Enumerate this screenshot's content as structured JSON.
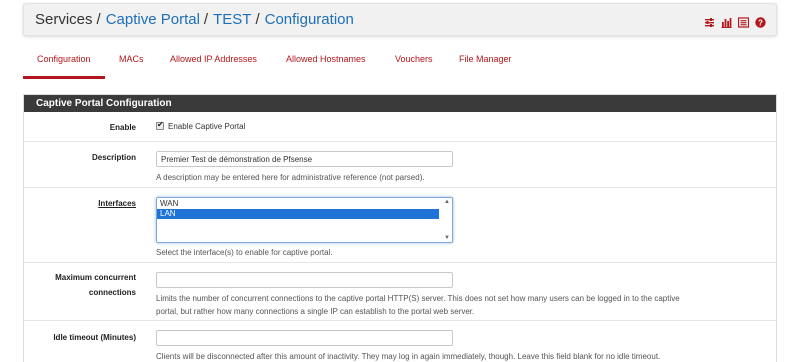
{
  "breadcrumb": {
    "items": [
      "Services",
      "Captive Portal",
      "TEST",
      "Configuration"
    ],
    "separator": "/"
  },
  "header_icons": [
    "sliders-icon",
    "bar-chart-icon",
    "list-icon",
    "help-icon"
  ],
  "tabs": [
    {
      "label": "Configuration",
      "active": true
    },
    {
      "label": "MACs"
    },
    {
      "label": "Allowed IP Addresses"
    },
    {
      "label": "Allowed Hostnames"
    },
    {
      "label": "Vouchers"
    },
    {
      "label": "File Manager"
    }
  ],
  "panel": {
    "title": "Captive Portal Configuration",
    "enable": {
      "label": "Enable",
      "checkbox_label": "Enable Captive Portal",
      "checked": true
    },
    "description": {
      "label": "Description",
      "value": "Premier Test de démonstration de Pfsense",
      "hint": "A description may be entered here for administrative reference (not parsed)."
    },
    "interfaces": {
      "label": "Interfaces",
      "options": [
        "WAN",
        "LAN"
      ],
      "selected": "LAN",
      "hint": "Select the interface(s) to enable for captive portal."
    },
    "max_connections": {
      "label_line1": "Maximum concurrent",
      "label_line2": "connections",
      "value": "",
      "hint_line1": "Limits the number of concurrent connections to the captive portal HTTP(S) server. This does not set how many users can be logged in to the captive",
      "hint_line2": "portal, but rather how many connections a single IP can establish to the portal web server."
    },
    "idle_timeout": {
      "label": "Idle timeout (Minutes)",
      "value": "",
      "hint": "Clients will be disconnected after this amount of inactivity. They may log in again immediately, though. Leave this field blank for no idle timeout."
    }
  },
  "colors": {
    "accent": "#b3171b",
    "link": "#1e6fb8",
    "panel_head": "#3a3a3a"
  }
}
